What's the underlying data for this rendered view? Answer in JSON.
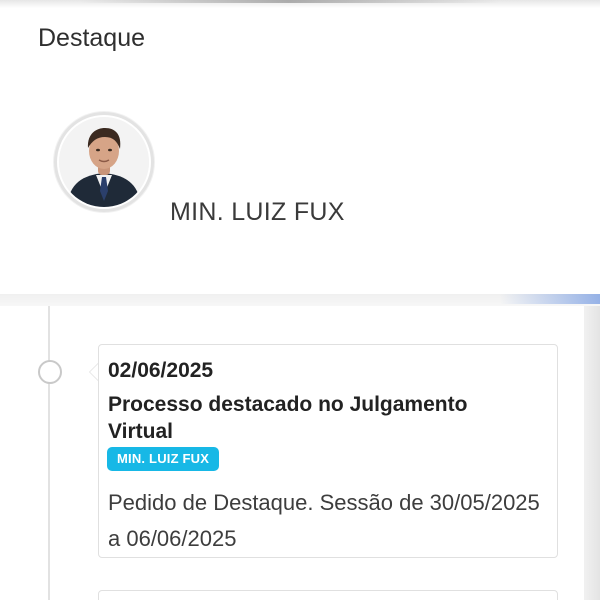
{
  "section": {
    "title": "Destaque"
  },
  "minister": {
    "name": "MIN. LUIZ FUX",
    "avatar_icon": "person-portrait-icon"
  },
  "timeline": {
    "events": [
      {
        "date": "02/06/2025",
        "title": "Processo destacado no Julgamento Virtual",
        "badge": "MIN. LUIZ FUX",
        "description": "Pedido de Destaque. Sessão de 30/05/2025 a 06/06/2025"
      }
    ]
  },
  "colors": {
    "badge_bg": "#17b8e6",
    "badge_text": "#ffffff",
    "card_border": "#e0e0e0",
    "timeline_dot": "#c9c9c9"
  }
}
